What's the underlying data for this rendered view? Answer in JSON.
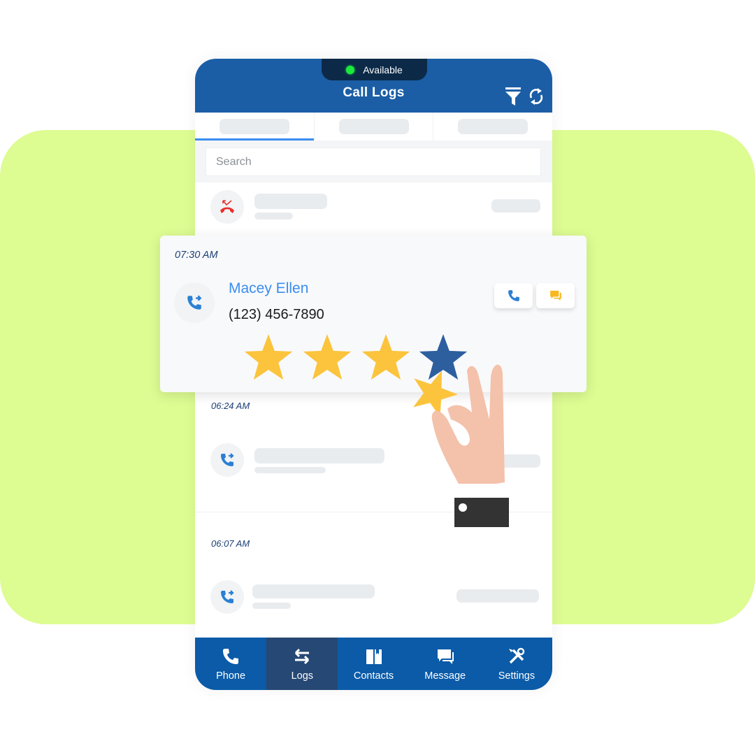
{
  "status": {
    "label": "Available",
    "color": "#1bea3c"
  },
  "header": {
    "title": "Call Logs",
    "icons": [
      "filter-icon",
      "refresh-icon"
    ],
    "color": "#1b5ea6"
  },
  "tabs": [
    {
      "label": "",
      "active": true
    },
    {
      "label": "",
      "active": false
    },
    {
      "label": "",
      "active": false
    }
  ],
  "search": {
    "placeholder": "Search",
    "value": ""
  },
  "call_logs": [
    {
      "time": "",
      "type": "missed-call",
      "name": "",
      "number": ""
    },
    {
      "time": "07:30 AM",
      "type": "outgoing-call",
      "name": "Macey Ellen",
      "number": "(123) 456-7890",
      "actions": [
        "call-button",
        "message-button"
      ]
    },
    {
      "time": "06:24 AM",
      "type": "outgoing-call",
      "name": "",
      "number": ""
    },
    {
      "time": "06:07 AM",
      "type": "outgoing-call",
      "name": "",
      "number": ""
    }
  ],
  "rating": {
    "value": 4,
    "max": 5,
    "filled_color": "#fbc43c",
    "selected_color": "#2d5f9f"
  },
  "nav": {
    "items": [
      {
        "label": "Phone",
        "icon": "phone-icon",
        "active": false
      },
      {
        "label": "Logs",
        "icon": "swap-arrows-icon",
        "active": true
      },
      {
        "label": "Contacts",
        "icon": "book-icon",
        "active": false
      },
      {
        "label": "Message",
        "icon": "chat-icon",
        "active": false
      },
      {
        "label": "Settings",
        "icon": "tools-icon",
        "active": false
      }
    ]
  },
  "colors": {
    "accent_green": "#ddfc92",
    "nav_bg": "#0b5ba8",
    "nav_active": "#264874",
    "link_blue": "#3a8df0"
  }
}
